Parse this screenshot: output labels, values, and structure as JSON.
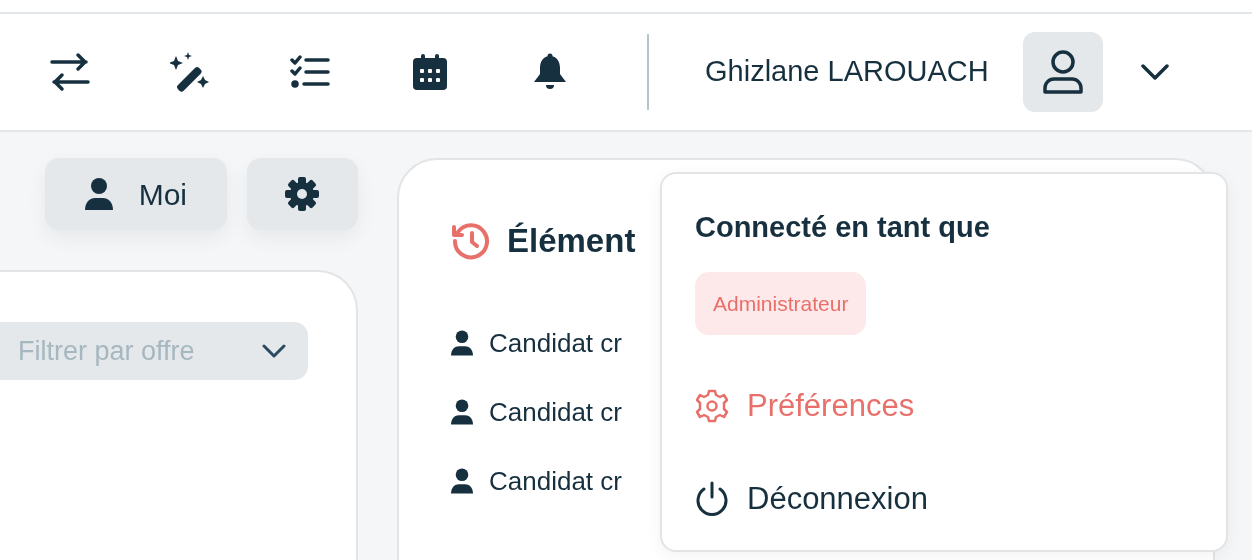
{
  "header": {
    "user_name": "Ghizlane LAROUACH"
  },
  "toolbar": {
    "me_button": "Moi"
  },
  "filter": {
    "placeholder": "Filtrer par offre"
  },
  "recent_panel": {
    "title": "Élément",
    "items": [
      "Candidat cr",
      "Candidat cr",
      "Candidat cr"
    ]
  },
  "user_menu": {
    "heading": "Connecté en tant que",
    "role": "Administrateur",
    "items": [
      {
        "label": "Préférences",
        "kind": "preferences",
        "selected": true
      },
      {
        "label": "Déconnexion",
        "kind": "logout",
        "selected": false
      }
    ]
  }
}
